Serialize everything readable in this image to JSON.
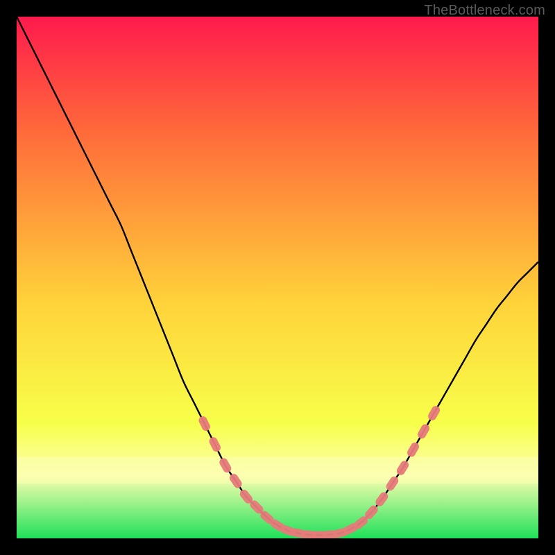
{
  "watermark": "TheBottleneck.com",
  "colors": {
    "bg": "#000000",
    "gradient_top": "#ff1a4d",
    "gradient_mid_upper": "#ff6a3a",
    "gradient_mid": "#ffd33a",
    "gradient_lower": "#f7ff4a",
    "gradient_band": "#fcffb0",
    "gradient_bottom": "#1fe05a",
    "curve": "#000000",
    "marker": "#e77a7a",
    "marker_stroke": "#e77a7a"
  },
  "chart_data": {
    "type": "line",
    "title": "",
    "xlabel": "",
    "ylabel": "",
    "xlim": [
      0,
      100
    ],
    "ylim": [
      0,
      100
    ],
    "x": [
      0,
      2,
      4,
      6,
      8,
      10,
      12,
      14,
      16,
      18,
      20,
      22,
      24,
      26,
      28,
      30,
      32,
      34,
      36,
      38,
      40,
      42,
      44,
      46,
      48,
      50,
      52,
      54,
      56,
      58,
      60,
      62,
      64,
      66,
      68,
      70,
      72,
      74,
      76,
      78,
      80,
      82,
      84,
      86,
      88,
      90,
      92,
      94,
      96,
      98,
      100
    ],
    "y": [
      100,
      96,
      92,
      88,
      84,
      80,
      76,
      72,
      68,
      64,
      60,
      55,
      50,
      45,
      40,
      35,
      30,
      26,
      22,
      18,
      14,
      11,
      8,
      6,
      4,
      2.5,
      1.5,
      1,
      0.7,
      0.6,
      0.7,
      1,
      1.8,
      3,
      5,
      7.5,
      10.5,
      13.5,
      17,
      20.5,
      24,
      27.5,
      31,
      34.5,
      38,
      41,
      44,
      46.5,
      49,
      51,
      53
    ],
    "markers_x": [
      36,
      38,
      40,
      42,
      44,
      46,
      48,
      50,
      52,
      54,
      56,
      58,
      60,
      62,
      64,
      66,
      68,
      70,
      72,
      74,
      76,
      78,
      80
    ],
    "markers_y": [
      22,
      18,
      14,
      11,
      8,
      6,
      4,
      2.5,
      1.5,
      1,
      0.7,
      0.6,
      0.7,
      1,
      1.8,
      3,
      5,
      7.5,
      10.5,
      13.5,
      17,
      20.5,
      24
    ]
  }
}
